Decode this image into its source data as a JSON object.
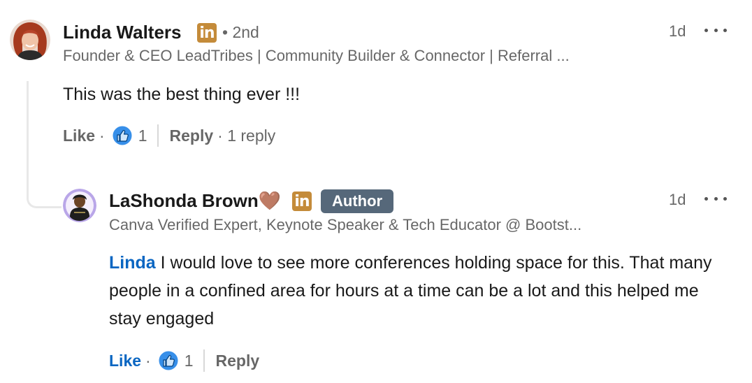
{
  "comment": {
    "author": "Linda Walters",
    "linkedin_badge": "in",
    "degree": "• 2nd",
    "headline": "Founder & CEO LeadTribes | Community Builder & Connector | Referral ...",
    "time": "1d",
    "text": "This was the best thing ever !!!",
    "actions": {
      "like": "Like",
      "sep": "·",
      "reaction_count": "1",
      "reply": "Reply",
      "replies": "· 1 reply"
    }
  },
  "reply": {
    "author": "LaShonda Brown🤎",
    "linkedin_badge": "in",
    "author_badge": "Author",
    "headline": "Canva Verified Expert, Keynote Speaker & Tech Educator @ Bootst...",
    "time": "1d",
    "mention": "Linda",
    "text": " I would love to see more conferences holding space for this. That many people in a confined area for hours at a time can be a lot and this helped me stay engaged",
    "actions": {
      "like": "Like",
      "sep": "·",
      "reaction_count": "1",
      "reply": "Reply"
    }
  },
  "colors": {
    "link_blue": "#0a66c2",
    "linkedin_gold": "#c48b3a",
    "author_badge": "#56687a",
    "thread_line": "#e8e8e8"
  },
  "icons": [
    "thumbs-up-reaction-icon",
    "more-options-icon",
    "linkedin-icon"
  ]
}
